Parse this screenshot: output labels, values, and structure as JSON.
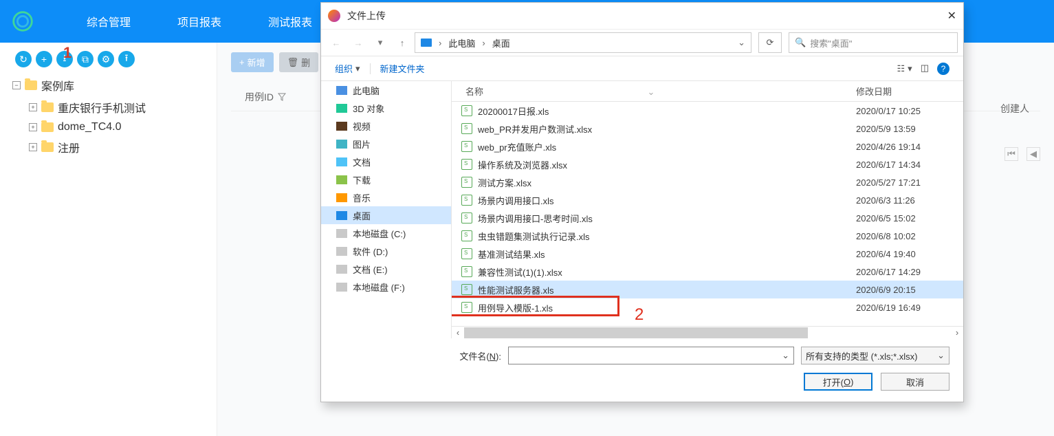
{
  "nav": {
    "item1": "综合管理",
    "item2": "项目报表",
    "item3": "测试报表"
  },
  "annot": {
    "one": "1",
    "two": "2"
  },
  "tree": {
    "root": "案例库",
    "n1": "重庆银行手机测试",
    "n2": "dome_TC4.0",
    "n3": "注册"
  },
  "toolbar": {
    "add": "新增",
    "del": "删"
  },
  "grid": {
    "id": "用例ID",
    "creator": "创建人"
  },
  "dialog": {
    "title": "文件上传",
    "bc1": "此电脑",
    "bc2": "桌面",
    "search_ph": "搜索\"桌面\"",
    "organize": "组织",
    "newfolder": "新建文件夹",
    "col_name": "名称",
    "col_date": "修改日期",
    "filename_label_pre": "文件名(",
    "filename_label_u": "N",
    "filename_label_post": "):",
    "filetype": "所有支持的类型 (*.xls;*.xlsx)",
    "open_pre": "打开(",
    "open_u": "O",
    "open_post": ")",
    "cancel": "取消"
  },
  "side": [
    {
      "label": "此电脑",
      "cls": "ico-pc"
    },
    {
      "label": "3D 对象",
      "cls": "ico-3d"
    },
    {
      "label": "视频",
      "cls": "ico-video"
    },
    {
      "label": "图片",
      "cls": "ico-pic"
    },
    {
      "label": "文档",
      "cls": "ico-doc"
    },
    {
      "label": "下载",
      "cls": "ico-down"
    },
    {
      "label": "音乐",
      "cls": "ico-music"
    },
    {
      "label": "桌面",
      "cls": "ico-desktop",
      "selected": true
    },
    {
      "label": "本地磁盘 (C:)",
      "cls": "ico-disk"
    },
    {
      "label": "软件 (D:)",
      "cls": "ico-disk"
    },
    {
      "label": "文档 (E:)",
      "cls": "ico-disk"
    },
    {
      "label": "本地磁盘 (F:)",
      "cls": "ico-disk"
    }
  ],
  "files": [
    {
      "name": "20200017日报.xls",
      "date": "2020/0/17 10:25"
    },
    {
      "name": "web_PR并发用户数测试.xlsx",
      "date": "2020/5/9 13:59"
    },
    {
      "name": "web_pr充值账户.xls",
      "date": "2020/4/26 19:14"
    },
    {
      "name": "操作系统及浏览器.xlsx",
      "date": "2020/6/17 14:34"
    },
    {
      "name": "测试方案.xlsx",
      "date": "2020/5/27 17:21"
    },
    {
      "name": "场景内调用接口.xls",
      "date": "2020/6/3 11:26"
    },
    {
      "name": "场景内调用接口-思考时间.xls",
      "date": "2020/6/5 15:02"
    },
    {
      "name": "虫虫错题集测试执行记录.xls",
      "date": "2020/6/8 10:02"
    },
    {
      "name": "基准测试结果.xls",
      "date": "2020/6/4 19:40"
    },
    {
      "name": "兼容性测试(1)(1).xlsx",
      "date": "2020/6/17 14:29"
    },
    {
      "name": "性能测试服务器.xls",
      "date": "2020/6/9 20:15",
      "sel": true
    },
    {
      "name": "用例导入模版-1.xls",
      "date": "2020/6/19 16:49"
    }
  ]
}
